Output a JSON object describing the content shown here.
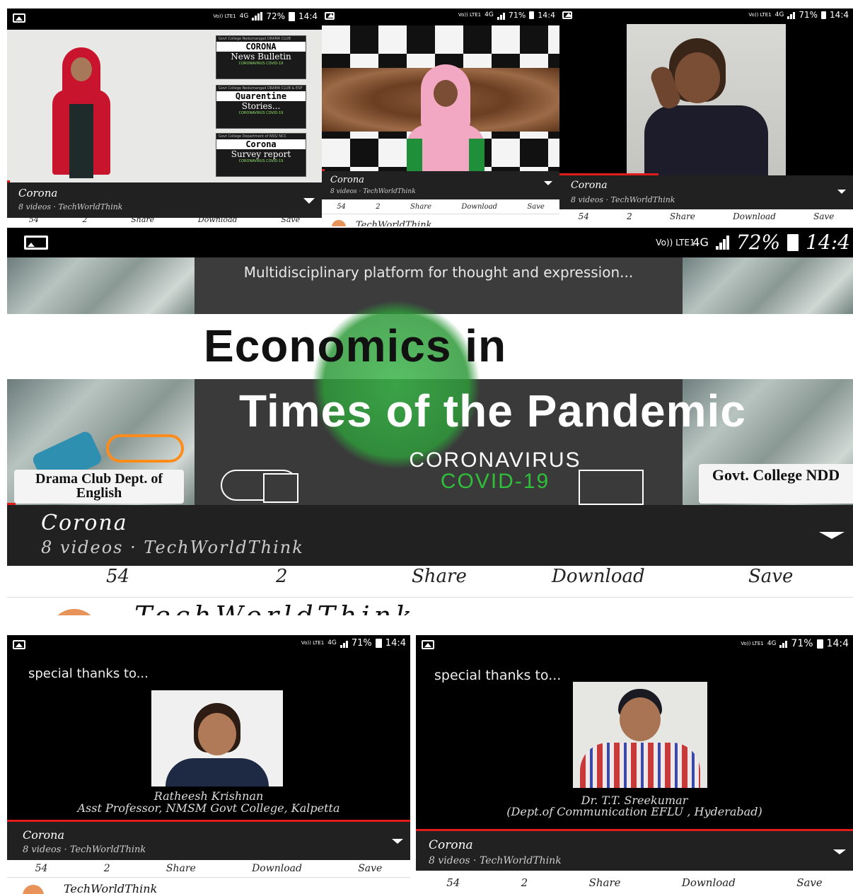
{
  "status": {
    "p1": {
      "lte": "Vo)) LTE1",
      "net": "4G",
      "battery": "72%",
      "time": "14:4"
    },
    "p2": {
      "lte": "Vo)) LTE1",
      "net": "4G",
      "battery": "71%",
      "time": "14:4"
    },
    "p3": {
      "lte": "Vo)) LTE1",
      "net": "4G",
      "battery": "71%",
      "time": "14:4"
    },
    "p4": {
      "lte": "Vo)) LTE1",
      "net": "4G",
      "battery": "72%",
      "time": "14:4"
    },
    "p5": {
      "lte": "Vo)) LTE1",
      "net": "4G",
      "battery": "71%",
      "time": "14:4"
    },
    "p6": {
      "lte": "Vo)) LTE1",
      "net": "4G",
      "battery": "71%",
      "time": "14:4"
    }
  },
  "playlist": {
    "title": "Corona",
    "subtitle": "8 videos · TechWorldThink"
  },
  "actions": {
    "likes": "54",
    "dislikes": "2",
    "share": "Share",
    "download": "Download",
    "save": "Save"
  },
  "channel_partial": "TechWorldThink",
  "panel1": {
    "cards": [
      {
        "small": "Govt College Nedumangad DRAMA CLUB",
        "head": "CORONA",
        "body": "News Bulletin",
        "foot": "CORONAVIRUS COVID-19"
      },
      {
        "small": "Govt College Nedumangad DRAMA CLUB & ESP",
        "head": "Quarentine",
        "body": "Stories...",
        "foot": "CORONAVIRUS COVID-19"
      },
      {
        "small": "Govt College Department of NSS/ NCC",
        "head": "Corona",
        "body": "Survey report",
        "foot": "CORONAVIRUS COVID-19"
      }
    ]
  },
  "panel4": {
    "tagline": "Multidisciplinary platform for thought and expression...",
    "title1": "Economics in",
    "title2": "Times of the Pandemic",
    "corona": "CORONAVIRUS",
    "covid": "COVID-19",
    "left_badge": "Drama Club Dept. of English",
    "right_badge": "Govt. College NDD",
    "colors": {
      "covid_green": "#2fbf3a",
      "progress_red": "#e31b1b"
    }
  },
  "panel5": {
    "thanks": "special thanks to...",
    "name": "Ratheesh Krishnan",
    "role": "Asst Professor, NMSM Govt College, Kalpetta"
  },
  "panel6": {
    "thanks": "special thanks to...",
    "name": "Dr. T.T. Sreekumar",
    "role": "(Dept.of Communication EFLU , Hyderabad)"
  }
}
